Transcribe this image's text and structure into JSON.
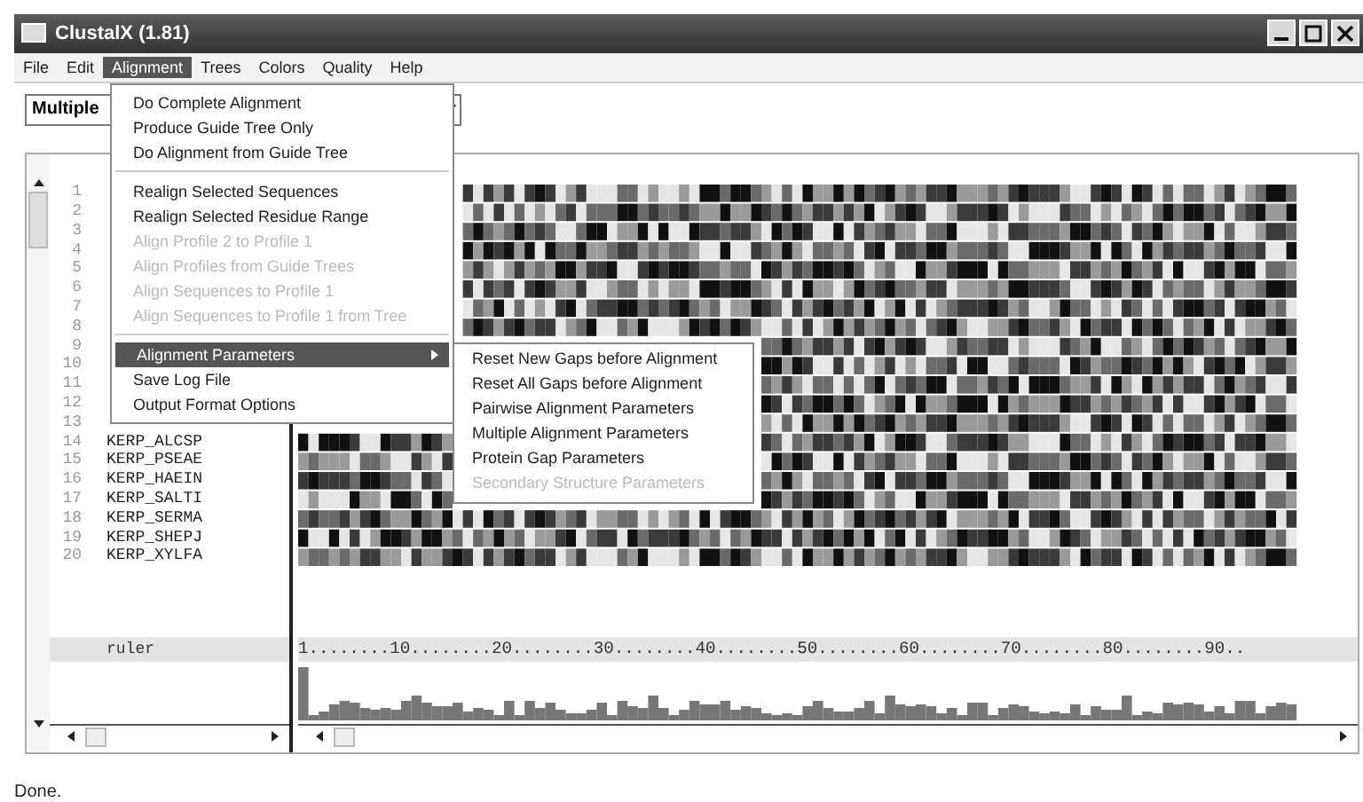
{
  "window": {
    "title": "ClustalX (1.81)"
  },
  "menu_bar": [
    {
      "label": "File",
      "selected": false
    },
    {
      "label": "Edit",
      "selected": false
    },
    {
      "label": "Alignment",
      "selected": true
    },
    {
      "label": "Trees",
      "selected": false
    },
    {
      "label": "Colors",
      "selected": false
    },
    {
      "label": "Quality",
      "selected": false
    },
    {
      "label": "Help",
      "selected": false
    }
  ],
  "mode_dropdown": {
    "value": "Multiple"
  },
  "alignment_menu": [
    {
      "kind": "item",
      "label": "Do Complete Alignment",
      "disabled": false,
      "selected": false
    },
    {
      "kind": "item",
      "label": "Produce Guide Tree Only",
      "disabled": false,
      "selected": false
    },
    {
      "kind": "item",
      "label": "Do Alignment from Guide Tree",
      "disabled": false,
      "selected": false
    },
    {
      "kind": "separator"
    },
    {
      "kind": "item",
      "label": "Realign Selected Sequences",
      "disabled": false,
      "selected": false
    },
    {
      "kind": "item",
      "label": "Realign Selected Residue Range",
      "disabled": false,
      "selected": false
    },
    {
      "kind": "item",
      "label": "Align Profile 2 to Profile 1",
      "disabled": true,
      "selected": false
    },
    {
      "kind": "item",
      "label": "Align Profiles from Guide Trees",
      "disabled": true,
      "selected": false
    },
    {
      "kind": "item",
      "label": "Align Sequences to Profile 1",
      "disabled": true,
      "selected": false
    },
    {
      "kind": "item",
      "label": "Align Sequences to Profile 1 from Tree",
      "disabled": true,
      "selected": false
    },
    {
      "kind": "separator"
    },
    {
      "kind": "submenu",
      "label": "Alignment Parameters",
      "disabled": false,
      "selected": true
    },
    {
      "kind": "item",
      "label": "Save Log File",
      "disabled": false,
      "selected": false
    },
    {
      "kind": "item",
      "label": "Output Format Options",
      "disabled": false,
      "selected": false
    }
  ],
  "parameters_submenu": [
    {
      "label": "Reset New Gaps before Alignment",
      "disabled": false
    },
    {
      "label": "Reset All Gaps before Alignment",
      "disabled": false
    },
    {
      "label": "Pairwise Alignment Parameters",
      "disabled": false
    },
    {
      "label": "Multiple Alignment Parameters",
      "disabled": false
    },
    {
      "label": "Protein Gap Parameters",
      "disabled": false
    },
    {
      "label": "Secondary Structure Parameters",
      "disabled": true
    }
  ],
  "sequences": [
    {
      "number": "1"
    },
    {
      "number": "2"
    },
    {
      "number": "3"
    },
    {
      "number": "4"
    },
    {
      "number": "5"
    },
    {
      "number": "6"
    },
    {
      "number": "7"
    },
    {
      "number": "8"
    },
    {
      "number": "9"
    },
    {
      "number": "10"
    },
    {
      "number": "11"
    },
    {
      "number": "12"
    },
    {
      "number": "13"
    },
    {
      "number": "14",
      "name": "KERP_ALCSP"
    },
    {
      "number": "15",
      "name": "KERP_PSEAE"
    },
    {
      "number": "16",
      "name": "KERP_HAEIN"
    },
    {
      "number": "17",
      "name": "KERP_SALTI"
    },
    {
      "number": "18",
      "name": "KERP_SERMA"
    },
    {
      "number": "19",
      "name": "KERP_SHEPJ"
    },
    {
      "number": "20",
      "name": "KERP_XYLFA"
    }
  ],
  "ruler": {
    "label": "ruler",
    "scale": "1........10........20........30........40........50........60........70........80........90.."
  },
  "status_bar": "Done."
}
